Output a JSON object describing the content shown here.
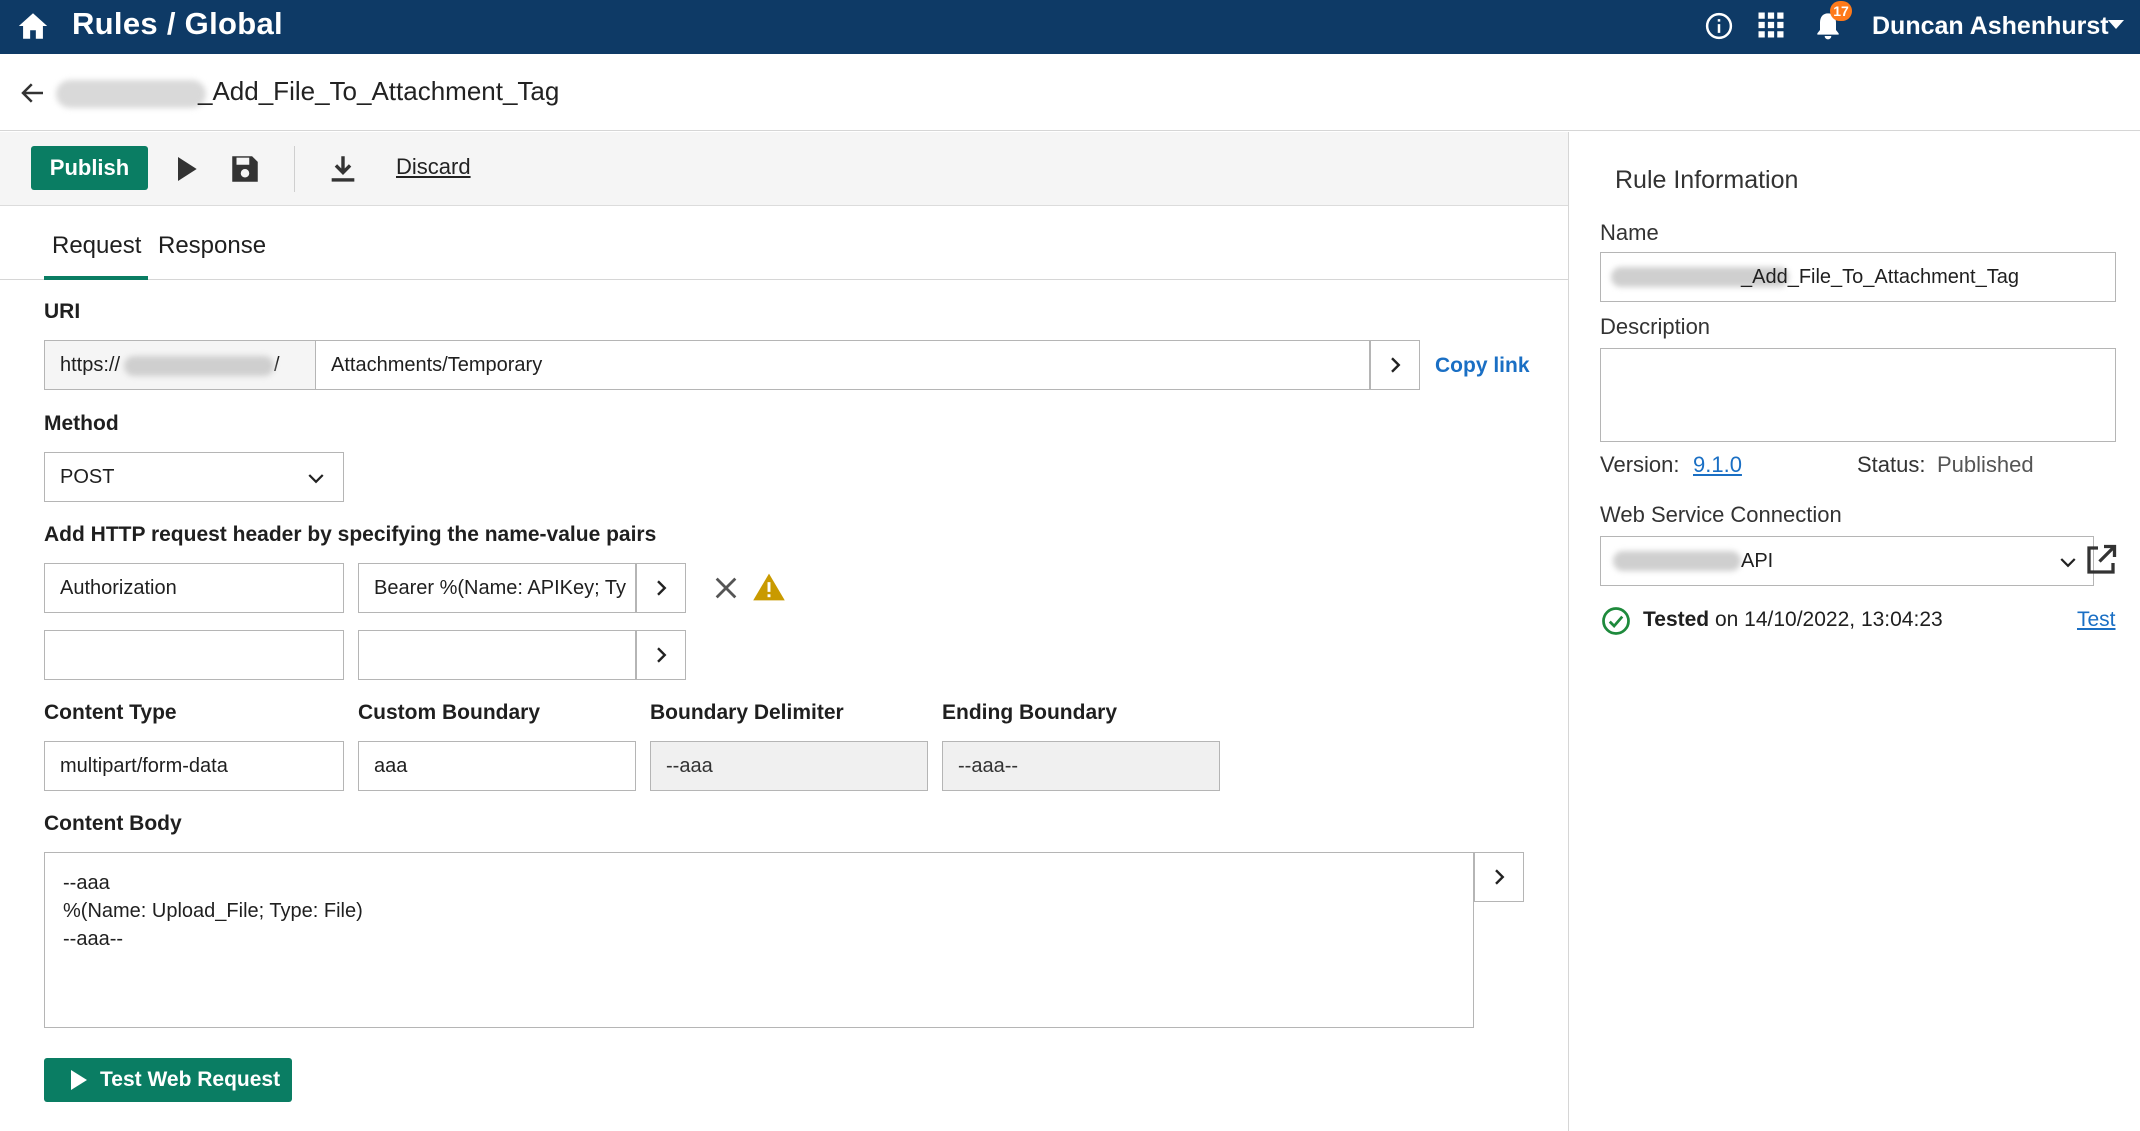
{
  "topbar": {
    "title": "Rules / Global",
    "user": "Duncan Ashenhurst",
    "notification_count": "17"
  },
  "breadcrumb": {
    "rule_name": "_Add_File_To_Attachment_Tag"
  },
  "toolbar": {
    "publish_label": "Publish",
    "discard_label": "Discard"
  },
  "tabs": [
    {
      "label": "Request",
      "active": true
    },
    {
      "label": "Response",
      "active": false
    }
  ],
  "request": {
    "uri_label": "URI",
    "uri_prefix": "https://",
    "uri_prefix_suffix": "/",
    "uri_path": "Attachments/Temporary",
    "copy_link_label": "Copy link",
    "method_label": "Method",
    "method_value": "POST",
    "headers_label": "Add HTTP request header by specifying the name-value pairs",
    "headers": [
      {
        "name": "Authorization",
        "value": "Bearer %(Name: APIKey; Ty"
      },
      {
        "name": "",
        "value": ""
      }
    ],
    "content_type_label": "Content Type",
    "content_type_value": "multipart/form-data",
    "custom_boundary_label": "Custom Boundary",
    "custom_boundary_value": "aaa",
    "boundary_delimiter_label": "Boundary Delimiter",
    "boundary_delimiter_value": "--aaa",
    "ending_boundary_label": "Ending Boundary",
    "ending_boundary_value": "--aaa--",
    "content_body_label": "Content Body",
    "content_body_lines": [
      "--aaa",
      "%(Name: Upload_File; Type: File)",
      "--aaa--"
    ],
    "test_button_label": "Test Web Request"
  },
  "rule_info": {
    "title": "Rule Information",
    "name_label": "Name",
    "name_value": "_Add_File_To_Attachment_Tag",
    "description_label": "Description",
    "version_label": "Version:",
    "version_value": "9.1.0",
    "status_label": "Status:",
    "status_value": "Published",
    "wsc_label": "Web Service Connection",
    "wsc_value": "API",
    "tested_word": "Tested",
    "tested_rest": " on 14/10/2022, 13:04:23",
    "test_link_label": "Test"
  },
  "colors": {
    "topbar": "#0e3a66",
    "primary_button": "#0a7d63",
    "link": "#1a6fc4",
    "warning": "#c99a00",
    "success": "#1e8a3c",
    "badge": "#ff7a1a"
  }
}
